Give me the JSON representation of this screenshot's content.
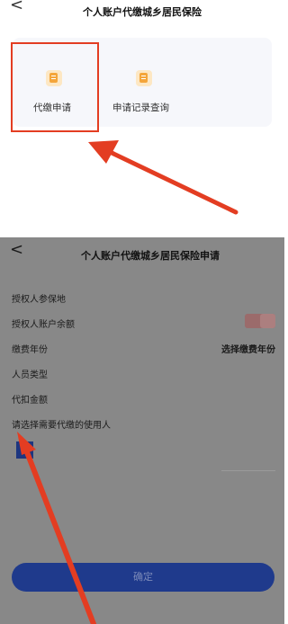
{
  "top_screen": {
    "back_glyph": "<",
    "title": "个人账户代缴城乡居民保险",
    "tiles": [
      {
        "label": "代缴申请",
        "icon": "document-icon"
      },
      {
        "label": "申请记录查询",
        "icon": "document-icon"
      }
    ]
  },
  "bottom_screen": {
    "back_glyph": "<",
    "title": "个人账户代缴城乡居民保险申请",
    "rows": [
      {
        "label": "授权人参保地",
        "value": ""
      },
      {
        "label": "授权人账户余额",
        "value": ""
      },
      {
        "label": "缴费年份",
        "value": "选择缴费年份"
      },
      {
        "label": "人员类型",
        "value": ""
      },
      {
        "label": "代扣金额",
        "value": ""
      },
      {
        "label": "请选择需要代缴的使用人",
        "value": ""
      }
    ],
    "confirm_label": "确定"
  },
  "colors": {
    "highlight": "#e33d22",
    "overlay": "#888888",
    "button": "#1f3a8c",
    "icon_accent": "#f4a53a"
  }
}
